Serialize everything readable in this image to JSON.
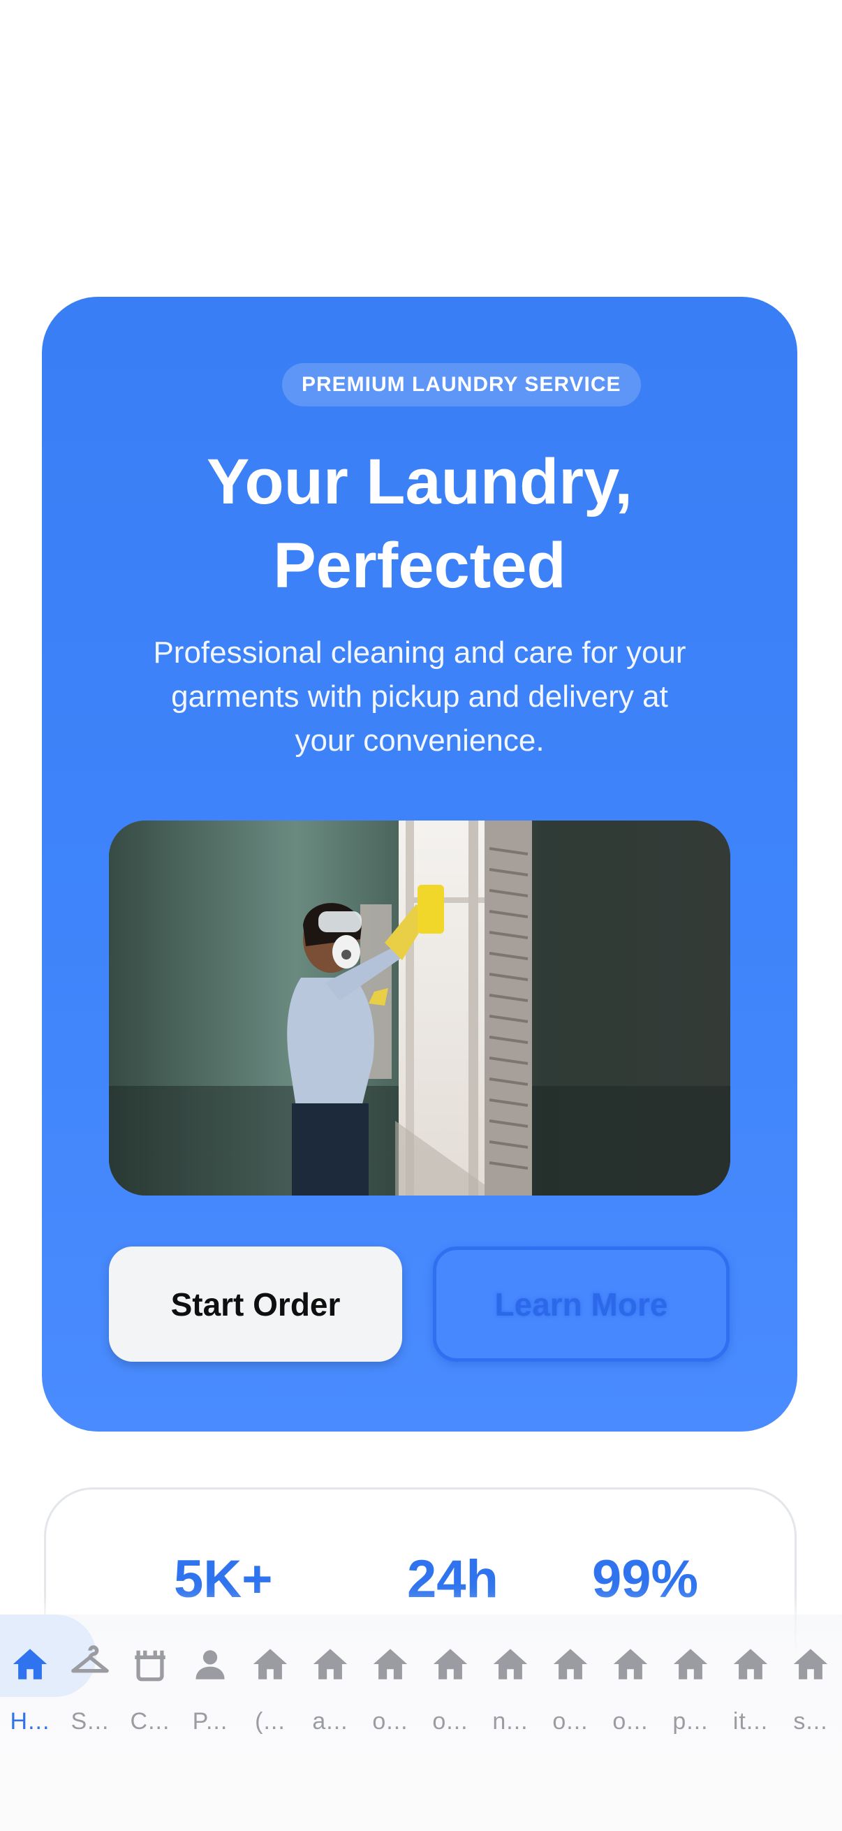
{
  "hero": {
    "badge": "PREMIUM LAUNDRY SERVICE",
    "title_line1": "Your Laundry,",
    "title_line2": "Perfected",
    "subtitle_line1": "Professional cleaning and care for your",
    "subtitle_line2": "garments with pickup and delivery at",
    "subtitle_line3": "your convenience.",
    "start_label": "Start Order",
    "learn_label": "Learn More"
  },
  "stats": {
    "items": [
      {
        "value": "5K+"
      },
      {
        "value": "24h"
      },
      {
        "value": "99%"
      }
    ]
  },
  "tabbar": {
    "tabs": [
      {
        "label": "H...",
        "icon": "home-icon",
        "active": true
      },
      {
        "label": "S...",
        "icon": "hanger-icon"
      },
      {
        "label": "C...",
        "icon": "basket-icon"
      },
      {
        "label": "P...",
        "icon": "person-icon"
      },
      {
        "label": "(...",
        "icon": "home-icon"
      },
      {
        "label": "a...",
        "icon": "home-icon"
      },
      {
        "label": "o...",
        "icon": "home-icon"
      },
      {
        "label": "o...",
        "icon": "home-icon"
      },
      {
        "label": "n...",
        "icon": "home-icon"
      },
      {
        "label": "o...",
        "icon": "home-icon"
      },
      {
        "label": "o...",
        "icon": "home-icon"
      },
      {
        "label": "p...",
        "icon": "home-icon"
      },
      {
        "label": "it...",
        "icon": "home-icon"
      },
      {
        "label": "s...",
        "icon": "home-icon"
      }
    ]
  },
  "colors": {
    "accent": "#2f74ee",
    "hero_bg": "#3f84fa",
    "tab_inactive": "#9a9ca2"
  }
}
